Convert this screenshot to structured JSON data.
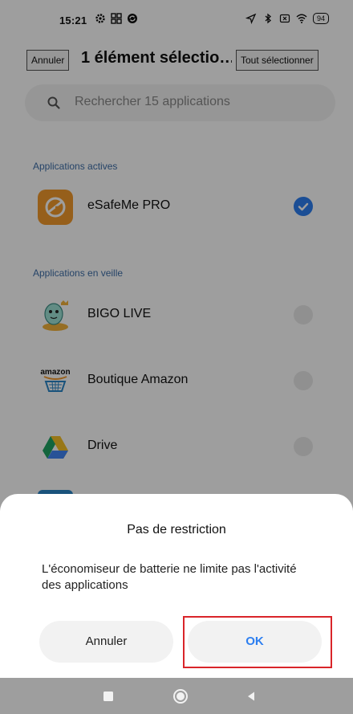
{
  "status_bar": {
    "time": "15:21",
    "battery": "94",
    "icons_left": [
      "settings-icon",
      "grid-icon",
      "sync-icon"
    ],
    "icons_right": [
      "location-icon",
      "bluetooth-icon",
      "no-sim-icon",
      "wifi-icon",
      "battery-icon"
    ]
  },
  "header": {
    "cancel_label": "Annuler",
    "title": "1 élément sélectio…",
    "select_all_label": "Tout sélectionner"
  },
  "search": {
    "placeholder": "Rechercher 15 applications",
    "icon": "search-icon"
  },
  "sections": {
    "active_label": "Applications actives",
    "standby_label": "Applications en veille"
  },
  "apps": {
    "esafeme": {
      "name": "eSafeMe PRO",
      "checked": true
    },
    "bigo": {
      "name": "BIGO LIVE",
      "checked": false
    },
    "amazon": {
      "name": "Boutique Amazon",
      "checked": false,
      "logo_text": "amazon"
    },
    "drive": {
      "name": "Drive",
      "checked": false
    }
  },
  "dialog": {
    "title": "Pas de restriction",
    "body": "L'économiseur de batterie ne limite pas l'activité des applications",
    "cancel_label": "Annuler",
    "ok_label": "OK"
  },
  "colors": {
    "accent": "#2d7ff0",
    "highlight": "#d9252a",
    "section_label": "#3e6ea8"
  },
  "nav_bar": {
    "icons": [
      "recents-square-icon",
      "home-circle-icon",
      "back-triangle-icon"
    ]
  }
}
